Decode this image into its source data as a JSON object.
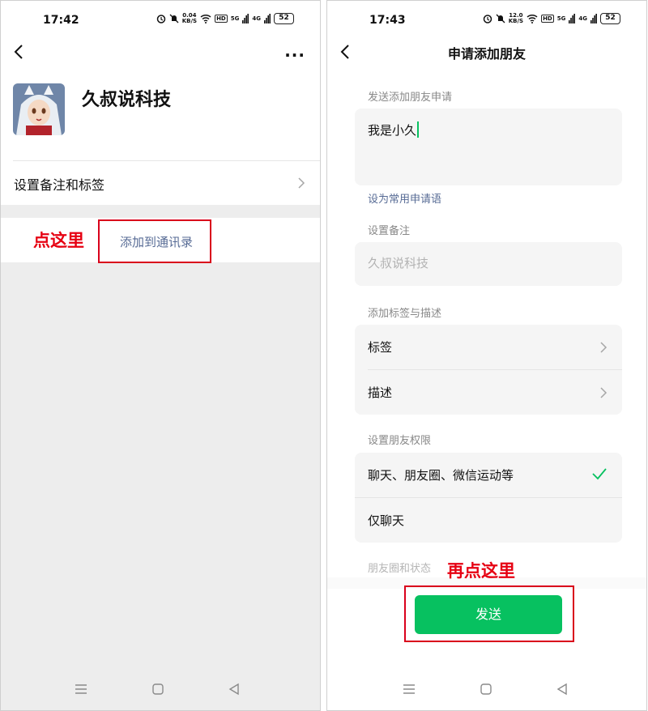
{
  "left_screen": {
    "status_bar": {
      "time": "17:42",
      "net_speed": "0.04",
      "net_unit": "KB/S",
      "hd": "HD",
      "signal_1": "5G",
      "signal_2": "4G",
      "battery": "52"
    },
    "contact_name": "久叔说科技",
    "remark_row_label": "设置备注和标签",
    "add_to_contacts_label": "添加到通讯录",
    "annotation": "点这里"
  },
  "right_screen": {
    "status_bar": {
      "time": "17:43",
      "net_speed": "12.0",
      "net_unit": "KB/S",
      "hd": "HD",
      "signal_1": "5G",
      "signal_2": "4G",
      "battery": "52"
    },
    "title": "申请添加朋友",
    "request_section_label": "发送添加朋友申请",
    "request_message": "我是小久",
    "set_common_phrase_link": "设为常用申请语",
    "remark_section_label": "设置备注",
    "remark_placeholder": "久叔说科技",
    "tags_section_label": "添加标签与描述",
    "tags_item": "标签",
    "description_item": "描述",
    "permission_section_label": "设置朋友权限",
    "permission_option_all": "聊天、朋友圈、微信运动等",
    "permission_option_chat_only": "仅聊天",
    "moments_section_label": "朋友圈和状态",
    "send_button": "发送",
    "annotation": "再点这里"
  },
  "colors": {
    "accent_green": "#07c160",
    "link_blue": "#576b95",
    "annotation_red": "#e60012"
  },
  "icons": [
    "back-arrow-icon",
    "more-dots-icon",
    "chevron-right-icon",
    "checkmark-icon",
    "alarm-icon",
    "mute-bell-icon",
    "wifi-icon",
    "menu-nav-icon",
    "home-nav-icon",
    "back-nav-icon"
  ]
}
